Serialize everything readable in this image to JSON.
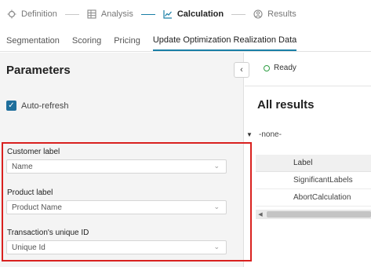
{
  "stepper": {
    "steps": [
      {
        "label": "Definition",
        "icon": "target-icon"
      },
      {
        "label": "Analysis",
        "icon": "table-icon"
      },
      {
        "label": "Calculation",
        "icon": "chart-icon",
        "active": true
      },
      {
        "label": "Results",
        "icon": "results-icon"
      }
    ]
  },
  "tabs": [
    "Segmentation",
    "Scoring",
    "Pricing",
    "Update Optimization Realization Data"
  ],
  "parameters": {
    "title": "Parameters",
    "collapse_icon": "chevron-left-icon",
    "autorefresh_label": "Auto-refresh",
    "autorefresh_checked": true,
    "fields": [
      {
        "label": "Customer label",
        "value": "Name"
      },
      {
        "label": "Product label",
        "value": "Product Name"
      },
      {
        "label": "Transaction's unique ID",
        "value": "Unique Id"
      }
    ]
  },
  "results": {
    "status": "Ready",
    "title": "All results",
    "group": "-none-",
    "columns": [
      "Label"
    ],
    "rows": [
      "SignificantLabels",
      "AbortCalculation"
    ]
  },
  "colors": {
    "accent": "#1a7fa6",
    "highlight": "#d9211f",
    "status_ok": "#2f9e44"
  }
}
